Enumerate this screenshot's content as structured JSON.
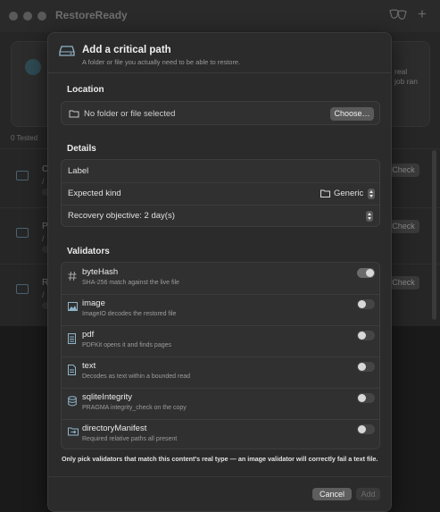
{
  "window": {
    "title": "RestoreReady",
    "status_text": "0  Tested"
  },
  "background": {
    "right_text_1": "real",
    "right_text_2": "job ran",
    "rows": [
      {
        "letter": "C",
        "sub": "/",
        "check": "Check"
      },
      {
        "letter": "P",
        "sub": "/",
        "check": "Check"
      },
      {
        "letter": "R",
        "sub": "/",
        "check": "Check"
      }
    ]
  },
  "sheet": {
    "title": "Add a critical path",
    "subtitle": "A folder or file you actually need to be able to restore.",
    "location": {
      "section": "Location",
      "placeholder": "No folder or file selected",
      "choose_label": "Choose…"
    },
    "details": {
      "section": "Details",
      "label_field": "Label",
      "kind_label": "Expected kind",
      "kind_value": "Generic",
      "recovery_label": "Recovery objective: 2 day(s)"
    },
    "validators": {
      "section": "Validators",
      "items": [
        {
          "name": "byteHash",
          "desc": "SHA-256 match against the live file",
          "icon": "hash-icon",
          "enabled": true
        },
        {
          "name": "image",
          "desc": "ImageIO decodes the restored file",
          "icon": "image-icon",
          "enabled": false
        },
        {
          "name": "pdf",
          "desc": "PDFKit opens it and finds pages",
          "icon": "pdf-doc-icon",
          "enabled": false
        },
        {
          "name": "text",
          "desc": "Decodes as text within a bounded read",
          "icon": "text-doc-icon",
          "enabled": false
        },
        {
          "name": "sqliteIntegrity",
          "desc": "PRAGMA integrity_check on the copy",
          "icon": "database-icon",
          "enabled": false
        },
        {
          "name": "directoryManifest",
          "desc": "Required relative paths all present",
          "icon": "folder-arrow-icon",
          "enabled": false
        }
      ]
    },
    "warning": "Only pick validators that match this content's real type — an image validator will correctly fail a text file.",
    "cancel_label": "Cancel",
    "add_label": "Add"
  },
  "colors": {
    "background": "#1a1a1a",
    "sheet": "#2b2b2b",
    "accent_icon": "#8fb4c8"
  }
}
